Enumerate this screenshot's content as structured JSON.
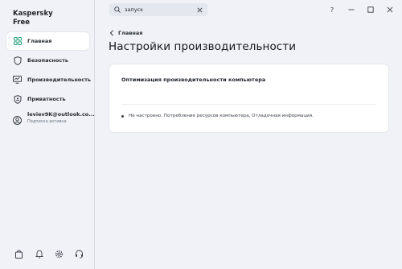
{
  "app": {
    "name_line1": "Kaspersky",
    "name_line2": "Free"
  },
  "search": {
    "value": "запуск",
    "placeholder": ""
  },
  "window_controls": {
    "help": "?",
    "minimize": "–",
    "maximize": "□",
    "close": "✕"
  },
  "sidebar": {
    "items": [
      {
        "label": "Главная",
        "icon": "home-grid-icon",
        "active": true
      },
      {
        "label": "Безопасность",
        "icon": "shield-icon",
        "active": false
      },
      {
        "label": "Производительность",
        "icon": "monitor-icon",
        "active": false
      },
      {
        "label": "Приватность",
        "icon": "privacy-shield-icon",
        "active": false
      }
    ],
    "account": {
      "email": "leviev9K@outlook.co...",
      "subtitle": "Подписка активна",
      "icon": "user-icon"
    },
    "bottom_icons": [
      "store-bag-icon",
      "bell-icon",
      "gear-icon",
      "headset-icon"
    ]
  },
  "breadcrumb": {
    "label": "Главная"
  },
  "page": {
    "title": "Настройки производительности"
  },
  "card": {
    "title": "Оптимизация производительности компьютера",
    "status": "Не настроено. Потребление ресурсов компьютера, Отладочная информация."
  },
  "colors": {
    "background": "#f0f2f7",
    "card": "#ffffff",
    "text": "#1f2329"
  }
}
